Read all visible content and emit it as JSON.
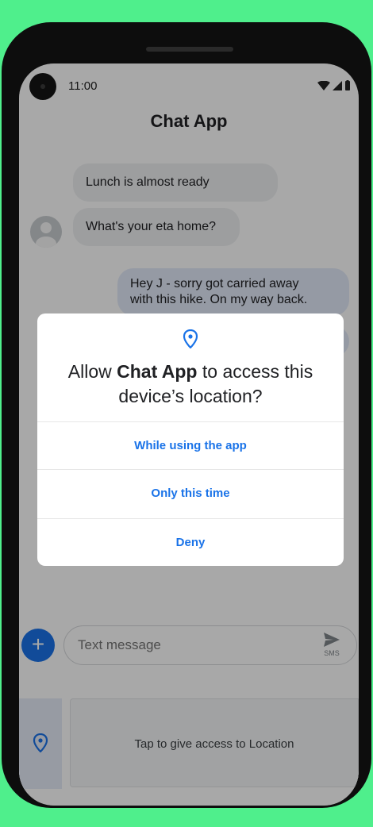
{
  "status_bar": {
    "time": "11:00"
  },
  "app": {
    "title": "Chat App"
  },
  "messages": [
    {
      "direction": "incoming",
      "text": "Lunch is almost ready"
    },
    {
      "direction": "incoming",
      "text": "What's your eta home?"
    },
    {
      "direction": "outgoing",
      "lines": [
        "Hey J - sorry got carried away",
        "with this hike. On my way back."
      ]
    }
  ],
  "compose": {
    "placeholder": "Text message",
    "send_label": "SMS"
  },
  "location_banner": {
    "text": "Tap to give access to Location"
  },
  "permission_dialog": {
    "title_prefix": "Allow ",
    "app_name": "Chat App",
    "title_suffix_line1": " to access this",
    "title_line2": "device’s location?",
    "options": [
      "While using the app",
      "Only this time",
      "Deny"
    ]
  },
  "colors": {
    "accent": "#1a73e8",
    "background": "#4fef8c",
    "incoming_bubble": "#eef0f2",
    "outgoing_bubble": "#e3eaf9"
  },
  "icons": {
    "location": "location-pin-icon",
    "add": "plus-icon",
    "send": "send-icon",
    "wifi": "wifi-icon",
    "signal": "signal-icon",
    "battery": "battery-icon",
    "avatar": "person-icon"
  }
}
